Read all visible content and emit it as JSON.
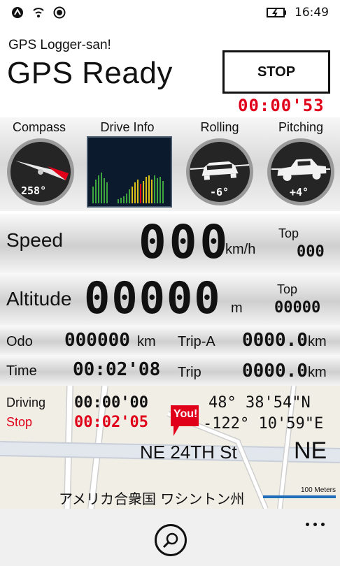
{
  "status": {
    "time": "16:49"
  },
  "header": {
    "subtitle": "GPS Logger-san!",
    "title": "GPS Ready",
    "stop_label": "STOP",
    "elapsed": "00:00'53"
  },
  "gauges": {
    "compass": {
      "label": "Compass",
      "value": "258°"
    },
    "drive_info": {
      "label": "Drive Info"
    },
    "rolling": {
      "label": "Rolling",
      "value": "-6°"
    },
    "pitching": {
      "label": "Pitching",
      "value": "+4°"
    }
  },
  "speed": {
    "label": "Speed",
    "value": "000",
    "unit": "km/h",
    "top_label": "Top",
    "top_value": "000"
  },
  "altitude": {
    "label": "Altitude",
    "value": "00000",
    "unit": "m",
    "top_label": "Top",
    "top_value": "00000"
  },
  "odo": {
    "label": "Odo",
    "value": "000000",
    "unit": "km",
    "trip_a_label": "Trip-A",
    "trip_a_value": "0000.0",
    "trip_a_unit": "km"
  },
  "time": {
    "label": "Time",
    "value": "00:02'08",
    "trip_label": "Trip",
    "trip_value": "0000.0",
    "trip_unit": "km"
  },
  "map": {
    "driving_label": "Driving",
    "driving_value": "00:00'00",
    "stop_label": "Stop",
    "stop_value": "00:02'05",
    "you_label": "You!",
    "lat": "48° 38'54\"N",
    "lon": "-122° 10'59\"E",
    "street": "NE 24TH St",
    "street_short": "NE",
    "region": "アメリカ合衆国 ワシントン州",
    "scale": "100 Meters"
  },
  "colors": {
    "red": "#e0001a",
    "dial": "#222222"
  }
}
